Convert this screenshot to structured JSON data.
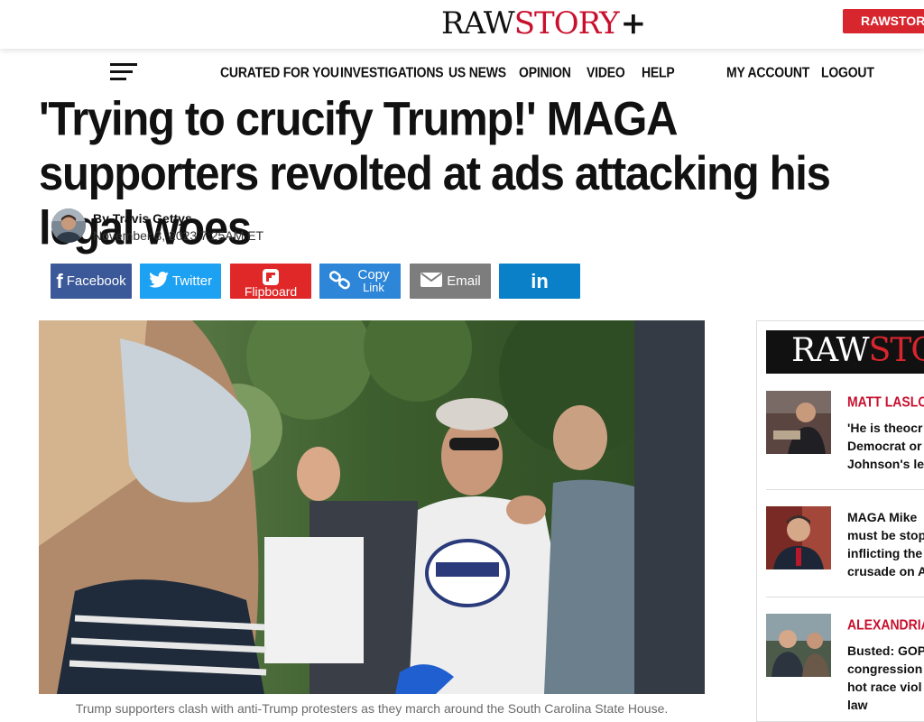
{
  "header": {
    "logo": {
      "raw": "RAW",
      "story": "STORY",
      "plus": "+"
    },
    "plus_button_label": "RAWSTORY+",
    "menu_icon": "hamburger-menu-icon"
  },
  "nav": {
    "items": [
      "CURATED FOR YOU",
      "INVESTIGATIONS",
      "US NEWS",
      "OPINION",
      "VIDEO",
      "HELP"
    ],
    "account": "MY ACCOUNT",
    "logout": "LOGOUT"
  },
  "article": {
    "headline": "'Trying to crucify Trump!' MAGA supporters revolted at ads attacking his legal woes",
    "author": "By Travis Gettys",
    "date": "November 3, 2023 7:25AM ET",
    "caption": "Trump supporters clash with anti-Trump protesters as they march around the South Carolina State House."
  },
  "share": {
    "facebook": "Facebook",
    "twitter": "Twitter",
    "flipboard": "Flipboard",
    "copy_link_1": "Copy",
    "copy_link_2": "Link",
    "email": "Email",
    "linkedin": "in"
  },
  "sidebar": {
    "logo": {
      "raw": "RAW",
      "story": "STORY"
    },
    "items": [
      {
        "author": "MATT LASLO",
        "lines": [
          "'He is theocr",
          "Democrat or",
          "Johnson's le"
        ]
      },
      {
        "author": "",
        "lines": [
          "MAGA Mike",
          "must be stop",
          "inflicting the",
          "crusade on A"
        ]
      },
      {
        "author": "ALEXANDRIA J",
        "lines": [
          "Busted: GOP",
          "congression",
          "hot race viol",
          "law"
        ]
      }
    ]
  },
  "colors": {
    "brand_red": "#c8102e",
    "facebook": "#3b5998",
    "twitter": "#1da1f2",
    "flipboard": "#e12828",
    "copy_link": "#2d86d7",
    "email": "#7d7d7d",
    "linkedin": "#0a80c9"
  }
}
